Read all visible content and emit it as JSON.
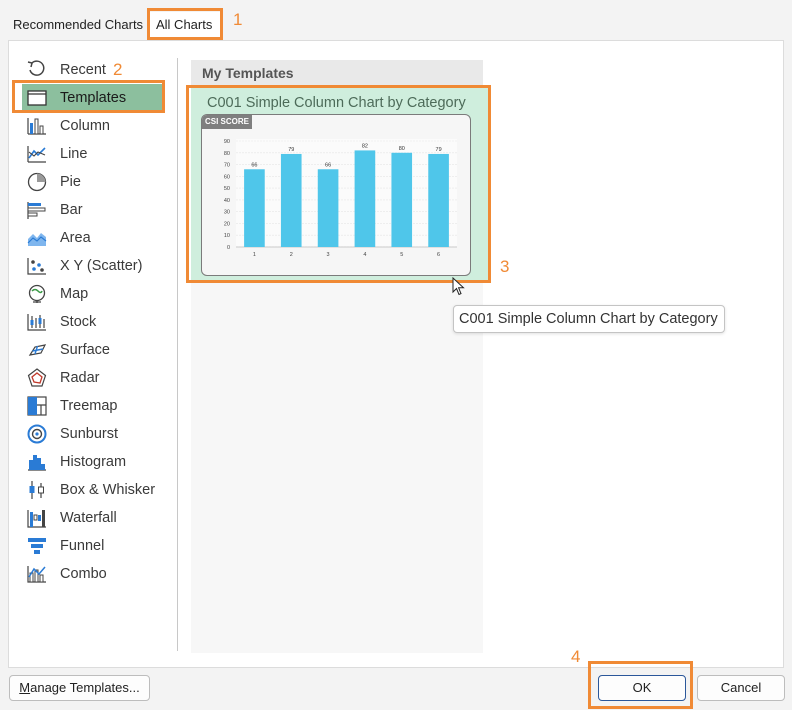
{
  "tabs": {
    "recommended": "Recommended Charts",
    "all": "All Charts"
  },
  "callouts": [
    "1",
    "2",
    "3",
    "4"
  ],
  "chart_types": [
    {
      "label": "Recent",
      "icon": "recent-icon"
    },
    {
      "label": "Templates",
      "icon": "folder-icon",
      "selected": true
    },
    {
      "label": "Column",
      "icon": "column-chart-icon"
    },
    {
      "label": "Line",
      "icon": "line-chart-icon"
    },
    {
      "label": "Pie",
      "icon": "pie-chart-icon"
    },
    {
      "label": "Bar",
      "icon": "bar-chart-icon"
    },
    {
      "label": "Area",
      "icon": "area-chart-icon"
    },
    {
      "label": "X Y (Scatter)",
      "icon": "scatter-chart-icon"
    },
    {
      "label": "Map",
      "icon": "map-chart-icon"
    },
    {
      "label": "Stock",
      "icon": "stock-chart-icon"
    },
    {
      "label": "Surface",
      "icon": "surface-chart-icon"
    },
    {
      "label": "Radar",
      "icon": "radar-chart-icon"
    },
    {
      "label": "Treemap",
      "icon": "treemap-chart-icon"
    },
    {
      "label": "Sunburst",
      "icon": "sunburst-chart-icon"
    },
    {
      "label": "Histogram",
      "icon": "histogram-chart-icon"
    },
    {
      "label": "Box & Whisker",
      "icon": "box-whisker-chart-icon"
    },
    {
      "label": "Waterfall",
      "icon": "waterfall-chart-icon"
    },
    {
      "label": "Funnel",
      "icon": "funnel-chart-icon"
    },
    {
      "label": "Combo",
      "icon": "combo-chart-icon"
    }
  ],
  "content": {
    "section_header": "My Templates",
    "template_title": "C001 Simple Column Chart by Category",
    "thumbnail_badge": "CSI SCORE"
  },
  "tooltip": "C001 Simple Column Chart by Category",
  "buttons": {
    "manage_prefix": "",
    "manage_underlined": "M",
    "manage_rest": "anage Templates...",
    "ok": "OK",
    "cancel": "Cancel"
  },
  "colors": {
    "accent_orange": "#f08a35",
    "selected_bg": "#8cbf9e",
    "tile_bg": "#cfeedd",
    "bar_color": "#4fc6ea"
  },
  "chart_data": {
    "type": "bar",
    "title": "CSI SCORE",
    "categories": [
      "1",
      "2",
      "3",
      "4",
      "5",
      "6"
    ],
    "values": [
      66,
      79,
      66,
      82,
      80,
      79
    ],
    "ylim": [
      0,
      90
    ],
    "yticks": [
      0,
      10,
      20,
      30,
      40,
      50,
      60,
      70,
      80,
      90
    ],
    "grid": true
  }
}
